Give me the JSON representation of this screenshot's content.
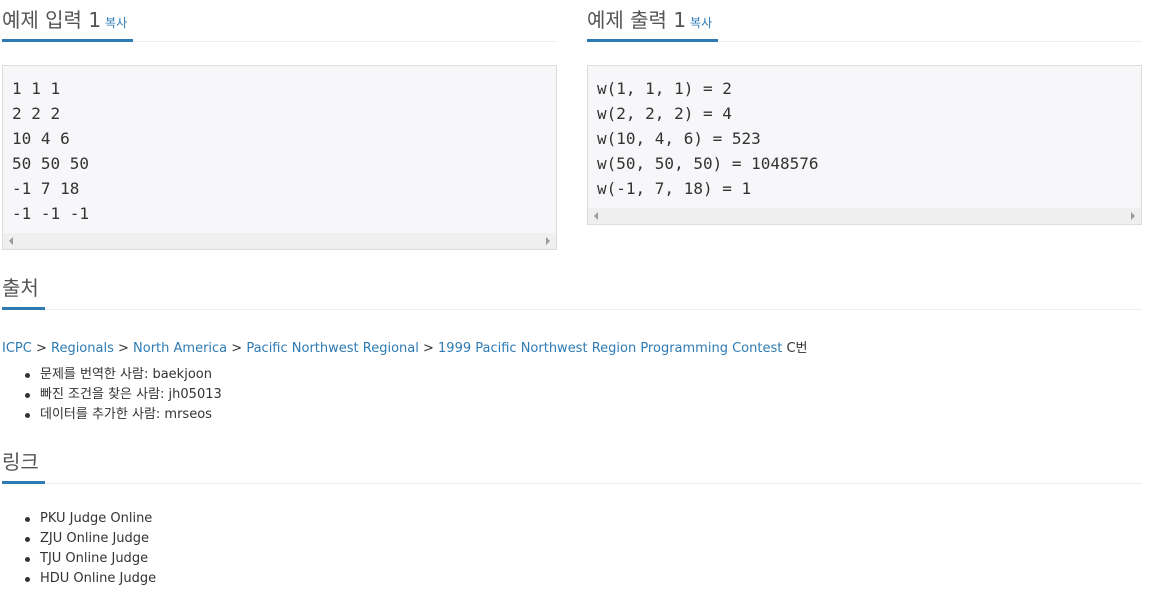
{
  "input_section": {
    "title": "예제 입력 1",
    "copy_label": "복사",
    "lines": "1 1 1\n2 2 2\n10 4 6\n50 50 50\n-1 7 18\n-1 -1 -1"
  },
  "output_section": {
    "title": "예제 출력 1",
    "copy_label": "복사",
    "lines": "w(1, 1, 1) = 2\nw(2, 2, 2) = 4\nw(10, 4, 6) = 523\nw(50, 50, 50) = 1048576\nw(-1, 7, 18) = 1"
  },
  "source": {
    "title": "출처",
    "breadcrumb": {
      "icpc": "ICPC",
      "sep": " > ",
      "regionals": "Regionals",
      "north_america": "North America",
      "pacific_nw": "Pacific Northwest Regional",
      "contest": "1999 Pacific Northwest Region Programming Contest",
      "suffix": " C번"
    },
    "credits": [
      "문제를 번역한 사람: baekjoon",
      "빠진 조건을 찾은 사람: jh05013",
      "데이터를 추가한 사람: mrseos"
    ]
  },
  "links": {
    "title": "링크",
    "items": [
      "PKU Judge Online",
      "ZJU Online Judge",
      "TJU Online Judge",
      "HDU Online Judge"
    ]
  },
  "colors": {
    "accent": "#2e7bb4",
    "code_bg": "#f7f7f9",
    "code_border": "#dddddd"
  }
}
